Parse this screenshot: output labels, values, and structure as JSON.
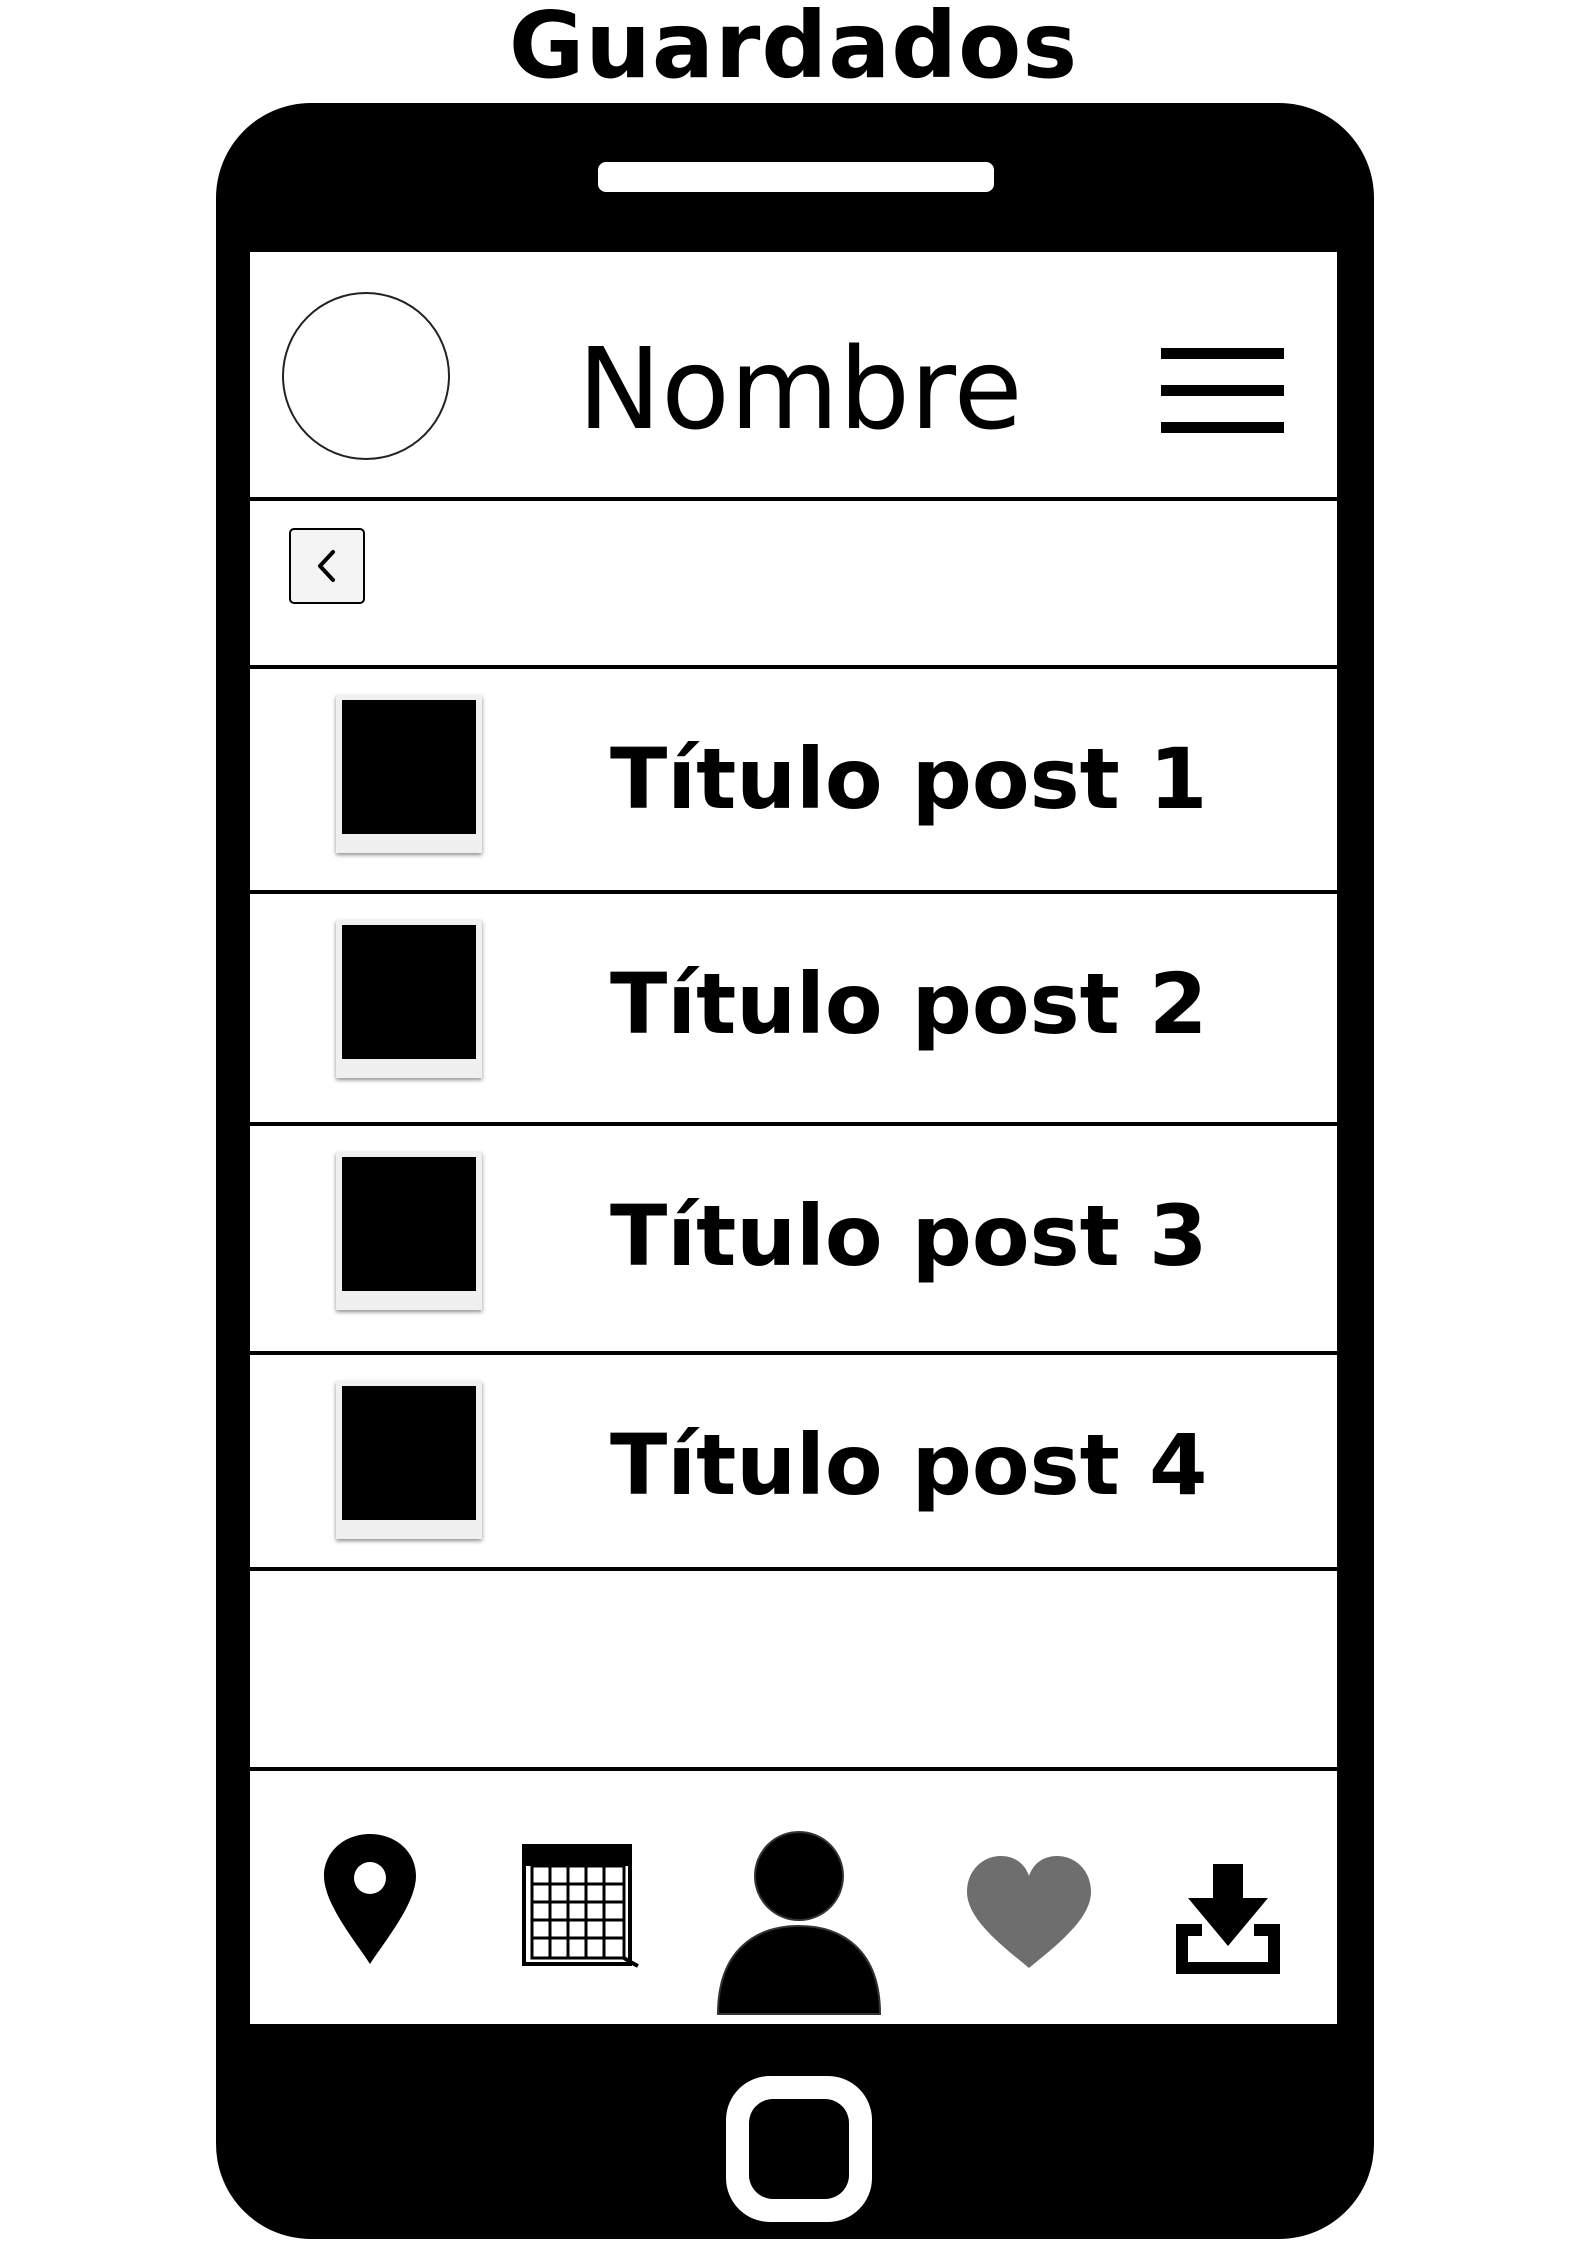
{
  "header": {
    "title": "Guardados"
  },
  "profile": {
    "name": "Nombre"
  },
  "posts": [
    {
      "title": "Título post 1"
    },
    {
      "title": "Título post 2"
    },
    {
      "title": "Título post 3"
    },
    {
      "title": "Título post 4"
    }
  ],
  "icons": {
    "menu": "hamburger-menu-icon",
    "back": "chevron-left-icon",
    "nav": [
      "location-pin-icon",
      "calendar-icon",
      "user-profile-icon",
      "heart-icon",
      "download-icon"
    ]
  },
  "colors": {
    "phone_body": "#000000",
    "screen": "#ffffff",
    "heart": "#6e6e6e"
  }
}
